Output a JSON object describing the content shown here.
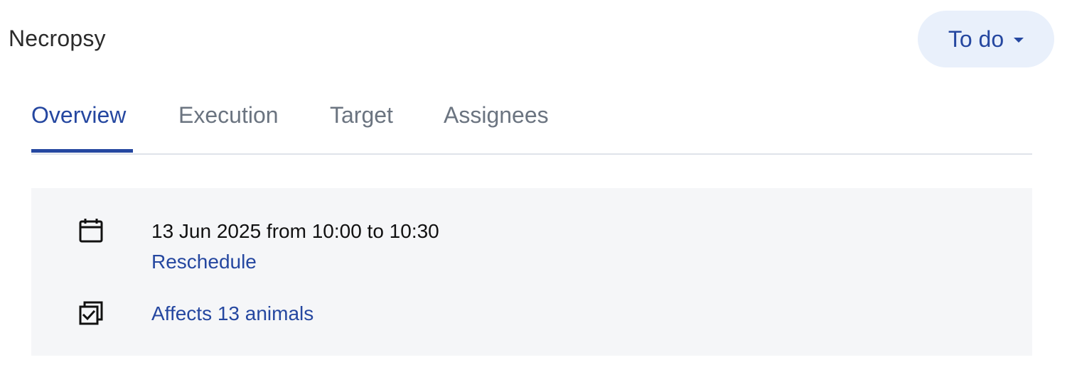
{
  "header": {
    "title": "Necropsy",
    "status": {
      "label": "To do",
      "background": "#e9f0fb",
      "color": "#2547a0"
    }
  },
  "tabs": [
    {
      "label": "Overview",
      "active": true
    },
    {
      "label": "Execution",
      "active": false
    },
    {
      "label": "Target",
      "active": false
    },
    {
      "label": "Assignees",
      "active": false
    }
  ],
  "overview": {
    "schedule": {
      "icon": "calendar-icon",
      "text": "13 Jun 2025 from 10:00 to 10:30",
      "action_label": "Reschedule"
    },
    "affects": {
      "icon": "multi-select-check-icon",
      "link_label": "Affects 13 animals"
    }
  },
  "colors": {
    "accent": "#2547a0",
    "muted_text": "#6b7480",
    "panel_background": "#f5f6f8",
    "divider": "#dfe3ea"
  }
}
